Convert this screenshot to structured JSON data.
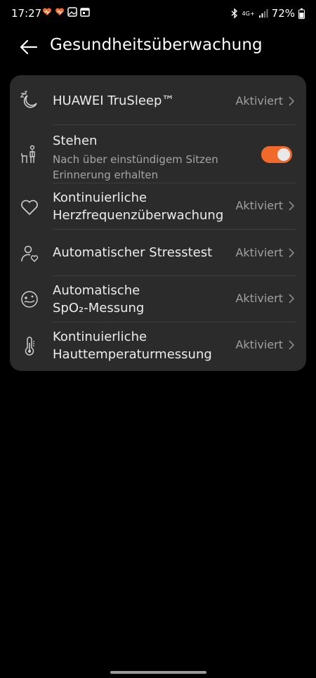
{
  "status_bar": {
    "time": "17:27",
    "network": "4G+",
    "battery": "72%"
  },
  "header": {
    "title": "Gesundheitsüberwachung"
  },
  "items": [
    {
      "title": "HUAWEI TruSleep™",
      "value": "Aktiviert",
      "icon": "sleep-icon"
    },
    {
      "title": "Stehen",
      "subtitle_line1": "Nach über einstündigem Sitzen",
      "subtitle_line2": "Erinnerung erhalten",
      "toggle_on": true,
      "icon": "standing-person-icon"
    },
    {
      "title_line1": "Kontinuierliche",
      "title_line2": "Herzfrequenzüberwachung",
      "value": "Aktiviert",
      "icon": "heart-icon"
    },
    {
      "title": "Automatischer Stresstest",
      "value": "Aktiviert",
      "icon": "stress-person-icon"
    },
    {
      "title_line1": "Automatische",
      "title_line2": "SpO₂-Messung",
      "value": "Aktiviert",
      "icon": "spo2-icon"
    },
    {
      "title_line1": "Kontinuierliche",
      "title_line2": "Hauttemperaturmessung",
      "value": "Aktiviert",
      "icon": "thermometer-icon"
    }
  ],
  "colors": {
    "accent": "#f26a2b",
    "card": "#2b2b2b",
    "background": "#000000"
  }
}
